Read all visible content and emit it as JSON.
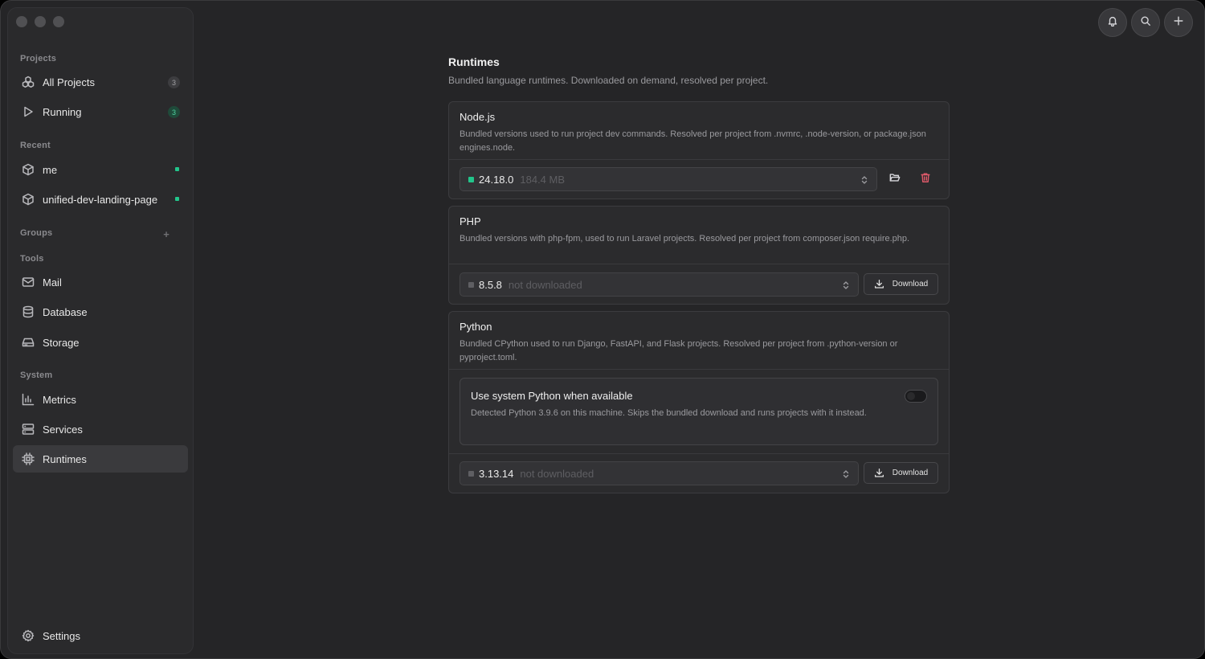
{
  "sidebar": {
    "projects_label": "Projects",
    "recent_label": "Recent",
    "groups_label": "Groups",
    "tools_label": "Tools",
    "system_label": "System",
    "projects": [
      {
        "label": "All Projects",
        "count": "3"
      },
      {
        "label": "Running",
        "count": "3"
      }
    ],
    "recent": [
      {
        "label": "me"
      },
      {
        "label": "unified-dev-landing-page"
      }
    ],
    "groups_add": "+",
    "tools": [
      {
        "label": "Mail"
      },
      {
        "label": "Database"
      },
      {
        "label": "Storage"
      }
    ],
    "system": [
      {
        "label": "Metrics"
      },
      {
        "label": "Services"
      },
      {
        "label": "Runtimes"
      }
    ],
    "settings_label": "Settings"
  },
  "main": {
    "title": "Runtimes",
    "subtitle": "Bundled language runtimes. Downloaded on demand, resolved per project."
  },
  "runtimes": {
    "node": {
      "title": "Node.js",
      "desc": "Bundled versions used to run project dev commands. Resolved per project from .nvmrc, .node-version, or package.json engines.node.",
      "version": "24.18.0",
      "meta": "184.4 MB"
    },
    "php": {
      "title": "PHP",
      "desc": "Bundled versions with php-fpm, used to run Laravel projects. Resolved per project from composer.json require.php.",
      "version": "8.5.8",
      "meta": "not downloaded",
      "download_label": "Download"
    },
    "python": {
      "title": "Python",
      "desc": "Bundled CPython used to run Django, FastAPI, and Flask projects. Resolved per project from .python-version or pyproject.toml.",
      "system_title": "Use system Python when available",
      "system_desc": "Detected Python 3.9.6 on this machine. Skips the bundled download and runs projects with it instead.",
      "version": "3.13.14",
      "meta": "not downloaded",
      "download_label": "Download"
    }
  },
  "colors": {
    "accent_green": "#22c58b",
    "danger": "#e05a6a",
    "background": "#252527"
  }
}
